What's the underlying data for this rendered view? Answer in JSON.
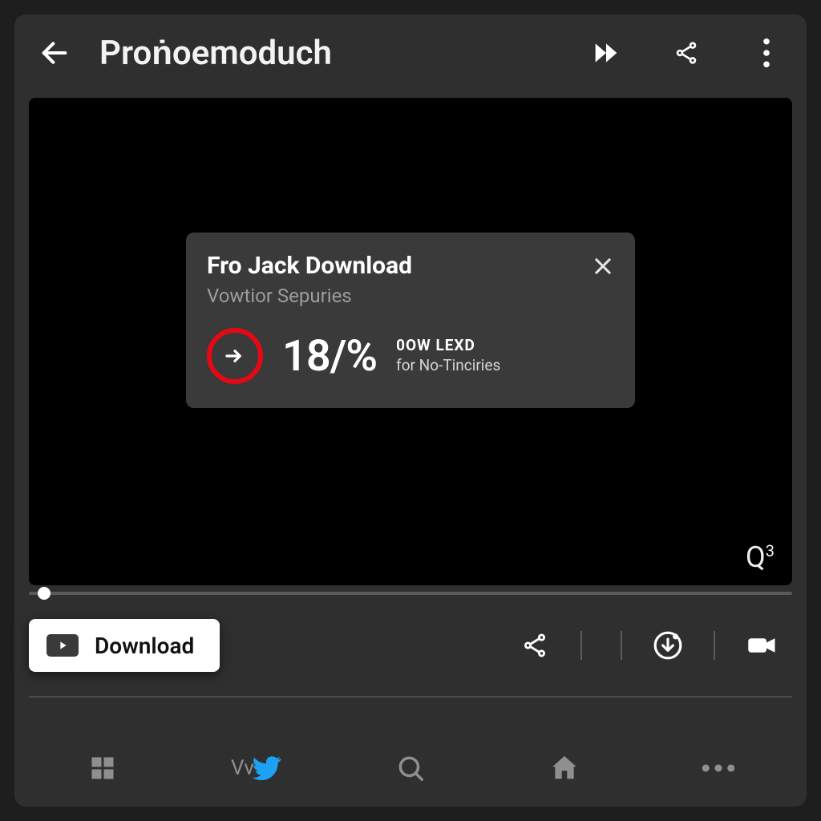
{
  "header": {
    "title": "Proṅoemoduch"
  },
  "popup": {
    "title": "Fro Jack Download",
    "subtitle": "Vowtior Sepuries",
    "percent": "18/%",
    "side_line1": "0OW LEXD",
    "side_line2": "for No-Tinciries"
  },
  "video": {
    "quality_label": "Q",
    "quality_sup": "3"
  },
  "actions": {
    "download_label": "Download"
  },
  "nav": {
    "vv_label": "Vv"
  },
  "icons": {
    "back": "back-arrow",
    "forward": "fast-forward",
    "share": "share",
    "more": "more-vert",
    "close": "close",
    "ring_arrow": "arrow-right-outline",
    "download_circle": "download-circle",
    "camera": "video-camera",
    "grid": "grid",
    "twitter": "twitter-bird",
    "search": "search",
    "home": "home",
    "dots": "more-horiz"
  }
}
